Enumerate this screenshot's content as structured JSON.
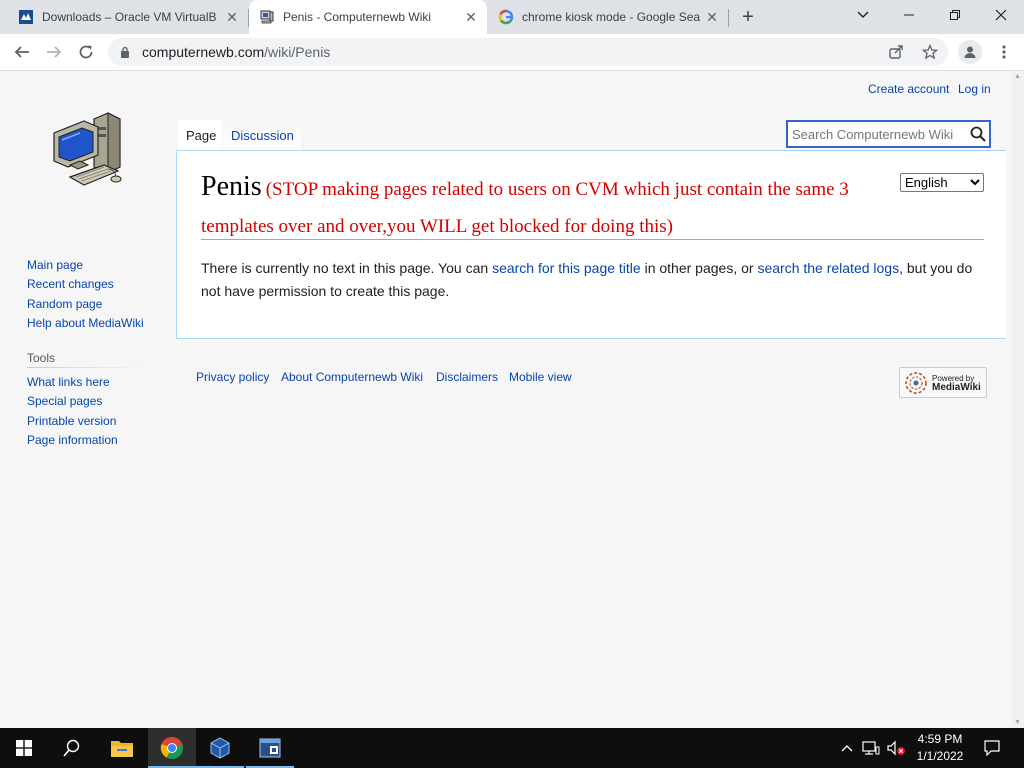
{
  "browser": {
    "tabs": [
      {
        "title": "Downloads – Oracle VM VirtualB",
        "favicon": "virtualbox-favicon",
        "active": false
      },
      {
        "title": "Penis - Computernewb Wiki",
        "favicon": "computernewb-favicon",
        "active": true
      },
      {
        "title": "chrome kiosk mode - Google Sea",
        "favicon": "google-favicon",
        "active": false
      }
    ],
    "url_host": "computernewb.com",
    "url_path": "/wiki/Penis"
  },
  "wiki": {
    "personal": {
      "create_account": "Create account",
      "log_in": "Log in"
    },
    "sidebar": {
      "navigation": [
        "Main page",
        "Recent changes",
        "Random page",
        "Help about MediaWiki"
      ],
      "tools_heading": "Tools",
      "tools": [
        "What links here",
        "Special pages",
        "Printable version",
        "Page information"
      ]
    },
    "tabs": {
      "page": "Page",
      "discussion": "Discussion"
    },
    "search_placeholder": "Search Computernewb Wiki",
    "language": {
      "selected": "English"
    },
    "title": "Penis",
    "title_note": "(STOP making pages related to users on CVM which just contain the same 3 templates over and over,you WILL get blocked for doing this)",
    "body": {
      "part1": "There is currently no text in this page. You can ",
      "link1": "search for this page title",
      "part2": " in other pages, or ",
      "link2": "search the related logs",
      "part3": ", but you do not have permission to create this page."
    },
    "footer": [
      "Privacy policy",
      "About Computernewb Wiki",
      "Disclaimers",
      "Mobile view"
    ],
    "powered_by": {
      "line1": "Powered by",
      "line2": "MediaWiki"
    }
  },
  "taskbar": {
    "time": "4:59 PM",
    "date": "1/1/2022",
    "colors": {
      "background": "#0e0e0e",
      "active_indicator": "#76b9ed"
    }
  },
  "colors": {
    "link": "#0645ad",
    "warning_red": "#d50000",
    "content_border": "#a7d7f9"
  }
}
